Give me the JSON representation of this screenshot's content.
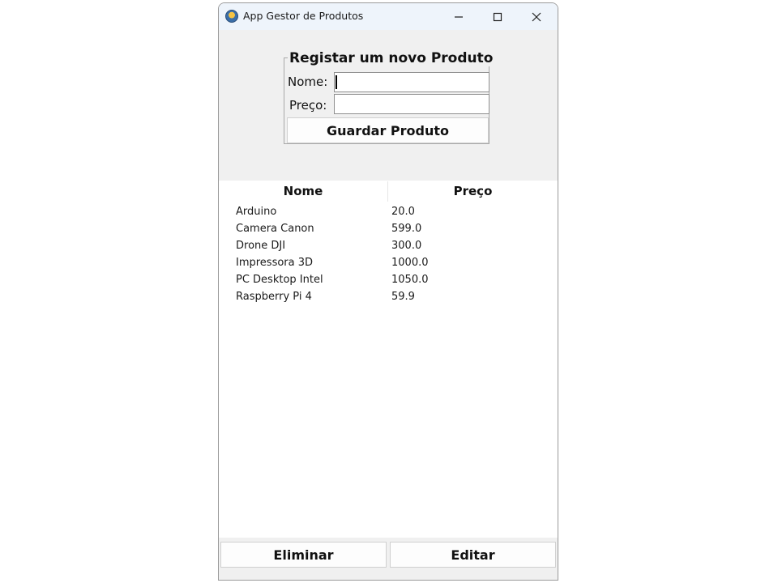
{
  "window": {
    "title": "App Gestor de Produtos"
  },
  "form": {
    "legend": "Registar um novo Produto",
    "nome_label": "Nome:",
    "preco_label": "Preço:",
    "nome_value": "",
    "preco_value": "",
    "save_label": "Guardar Produto"
  },
  "table": {
    "columns": [
      "Nome",
      "Preço"
    ],
    "rows": [
      [
        "Arduino",
        "20.0"
      ],
      [
        "Camera Canon",
        "599.0"
      ],
      [
        "Drone DJI",
        "300.0"
      ],
      [
        "Impressora 3D",
        "1000.0"
      ],
      [
        "PC Desktop Intel",
        "1050.0"
      ],
      [
        "Raspberry Pi 4",
        "59.9"
      ]
    ]
  },
  "actions": {
    "delete_label": "Eliminar",
    "edit_label": "Editar"
  },
  "icons": {
    "app": "app-globe-icon",
    "minimize": "minimize-icon",
    "maximize": "maximize-icon",
    "close": "close-icon"
  }
}
